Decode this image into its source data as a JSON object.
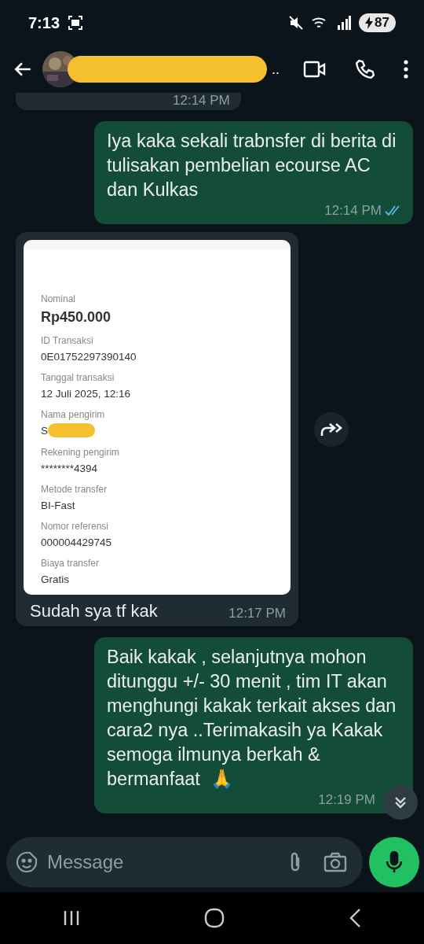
{
  "status_bar": {
    "time": "7:13",
    "battery": "87"
  },
  "header": {
    "contact_suffix": ".."
  },
  "messages": [
    {
      "kind": "partial",
      "outgoing": false,
      "time": "12:14 PM"
    },
    {
      "kind": "text",
      "outgoing": true,
      "text": "Iya kaka sekali trabnsfer di berita di tulisakan pembelian ecourse AC dan Kulkas",
      "time": "12:14 PM",
      "read": true
    },
    {
      "kind": "receipt",
      "outgoing": false,
      "caption": "Sudah sya tf kak",
      "time": "12:17 PM",
      "fields": [
        {
          "kind": "amount",
          "label": "Nominal",
          "value": "Rp450.000"
        },
        {
          "kind": "plain",
          "label": "ID Transaksi",
          "value": "0E01752297390140"
        },
        {
          "kind": "plain",
          "label": "Tanggal transaksi",
          "value": "12 Juli 2025, 12:16"
        },
        {
          "kind": "redacted",
          "label": "Nama pengirim",
          "value": "S"
        },
        {
          "kind": "plain",
          "label": "Rekening pengirim",
          "value": "********4394"
        },
        {
          "kind": "plain",
          "label": "Metode transfer",
          "value": "BI-Fast"
        },
        {
          "kind": "plain",
          "label": "Nomor referensi",
          "value": "000004429745"
        },
        {
          "kind": "plain",
          "label": "Biaya transfer",
          "value": "Gratis"
        }
      ]
    },
    {
      "kind": "text",
      "outgoing": true,
      "text": "Baik kakak , selanjutnya mohon ditunggu +/- 30 menit , tim IT akan menghungi kakak terkait akses dan cara2 nya ..Terimakasih ya Kakak semoga ilmunya berkah & bermanfaat  🙏",
      "time": "12:19 PM",
      "read": false
    }
  ],
  "composer": {
    "placeholder": "Message"
  }
}
